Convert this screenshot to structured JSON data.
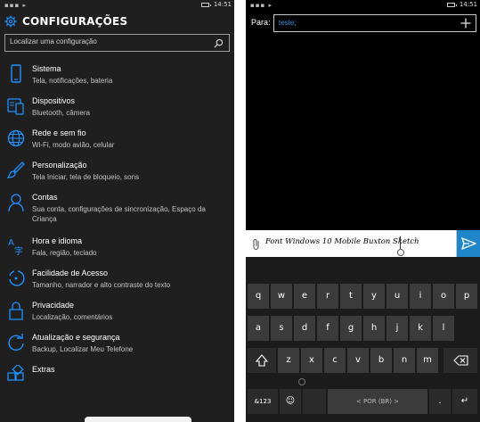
{
  "left": {
    "status": {
      "signal": "▪▪▪ ▸",
      "time": "14:51"
    },
    "header": {
      "title": "CONFIGURAÇÕES"
    },
    "search": {
      "placeholder": "Localizar uma configuração"
    },
    "items": [
      {
        "label": "Sistema",
        "sub": "Tela, notificações, bateria",
        "icon": "phone-icon"
      },
      {
        "label": "Dispositivos",
        "sub": "Bluetooth, câmera",
        "icon": "devices-icon"
      },
      {
        "label": "Rede e sem fio",
        "sub": "Wi-Fi, modo avião, celular",
        "icon": "globe-icon"
      },
      {
        "label": "Personalização",
        "sub": "Tela Iniciar, tela de bloqueio, sons",
        "icon": "paintbrush-icon"
      },
      {
        "label": "Contas",
        "sub": "Sua conta, configurações de sincronização, Espaço da Criança",
        "icon": "person-icon"
      },
      {
        "label": "Hora e idioma",
        "sub": "Fala, região, teclado",
        "icon": "language-icon"
      },
      {
        "label": "Facilidade de Acesso",
        "sub": "Tamanho, narrador e alto contraste do texto",
        "icon": "accessibility-icon"
      },
      {
        "label": "Privacidade",
        "sub": "Localização, comentários",
        "icon": "lock-icon"
      },
      {
        "label": "Atualização e segurança",
        "sub": "Backup, Localizar Meu Telefone",
        "icon": "update-icon"
      },
      {
        "label": "Extras",
        "sub": "",
        "icon": "extras-icon"
      }
    ]
  },
  "right": {
    "status": {
      "signal": "▪▪▪ ▸",
      "time": "14:51"
    },
    "to_label": "Para:",
    "to_value": "teste;",
    "message": "Font Windows 10 Mobile Buxton Sketch",
    "keyboard": {
      "row1": [
        "q",
        "w",
        "e",
        "r",
        "t",
        "y",
        "u",
        "i",
        "o",
        "p"
      ],
      "row2": [
        "a",
        "s",
        "d",
        "f",
        "g",
        "h",
        "j",
        "k",
        "l"
      ],
      "row3": [
        "z",
        "x",
        "c",
        "v",
        "b",
        "n",
        "m"
      ],
      "symbols_key": "&123",
      "emoji_key": "☺",
      "space_label": "< POR (BR) >",
      "period_key": ".",
      "enter_key": "↵"
    },
    "accent_color": "#1f87c9"
  }
}
